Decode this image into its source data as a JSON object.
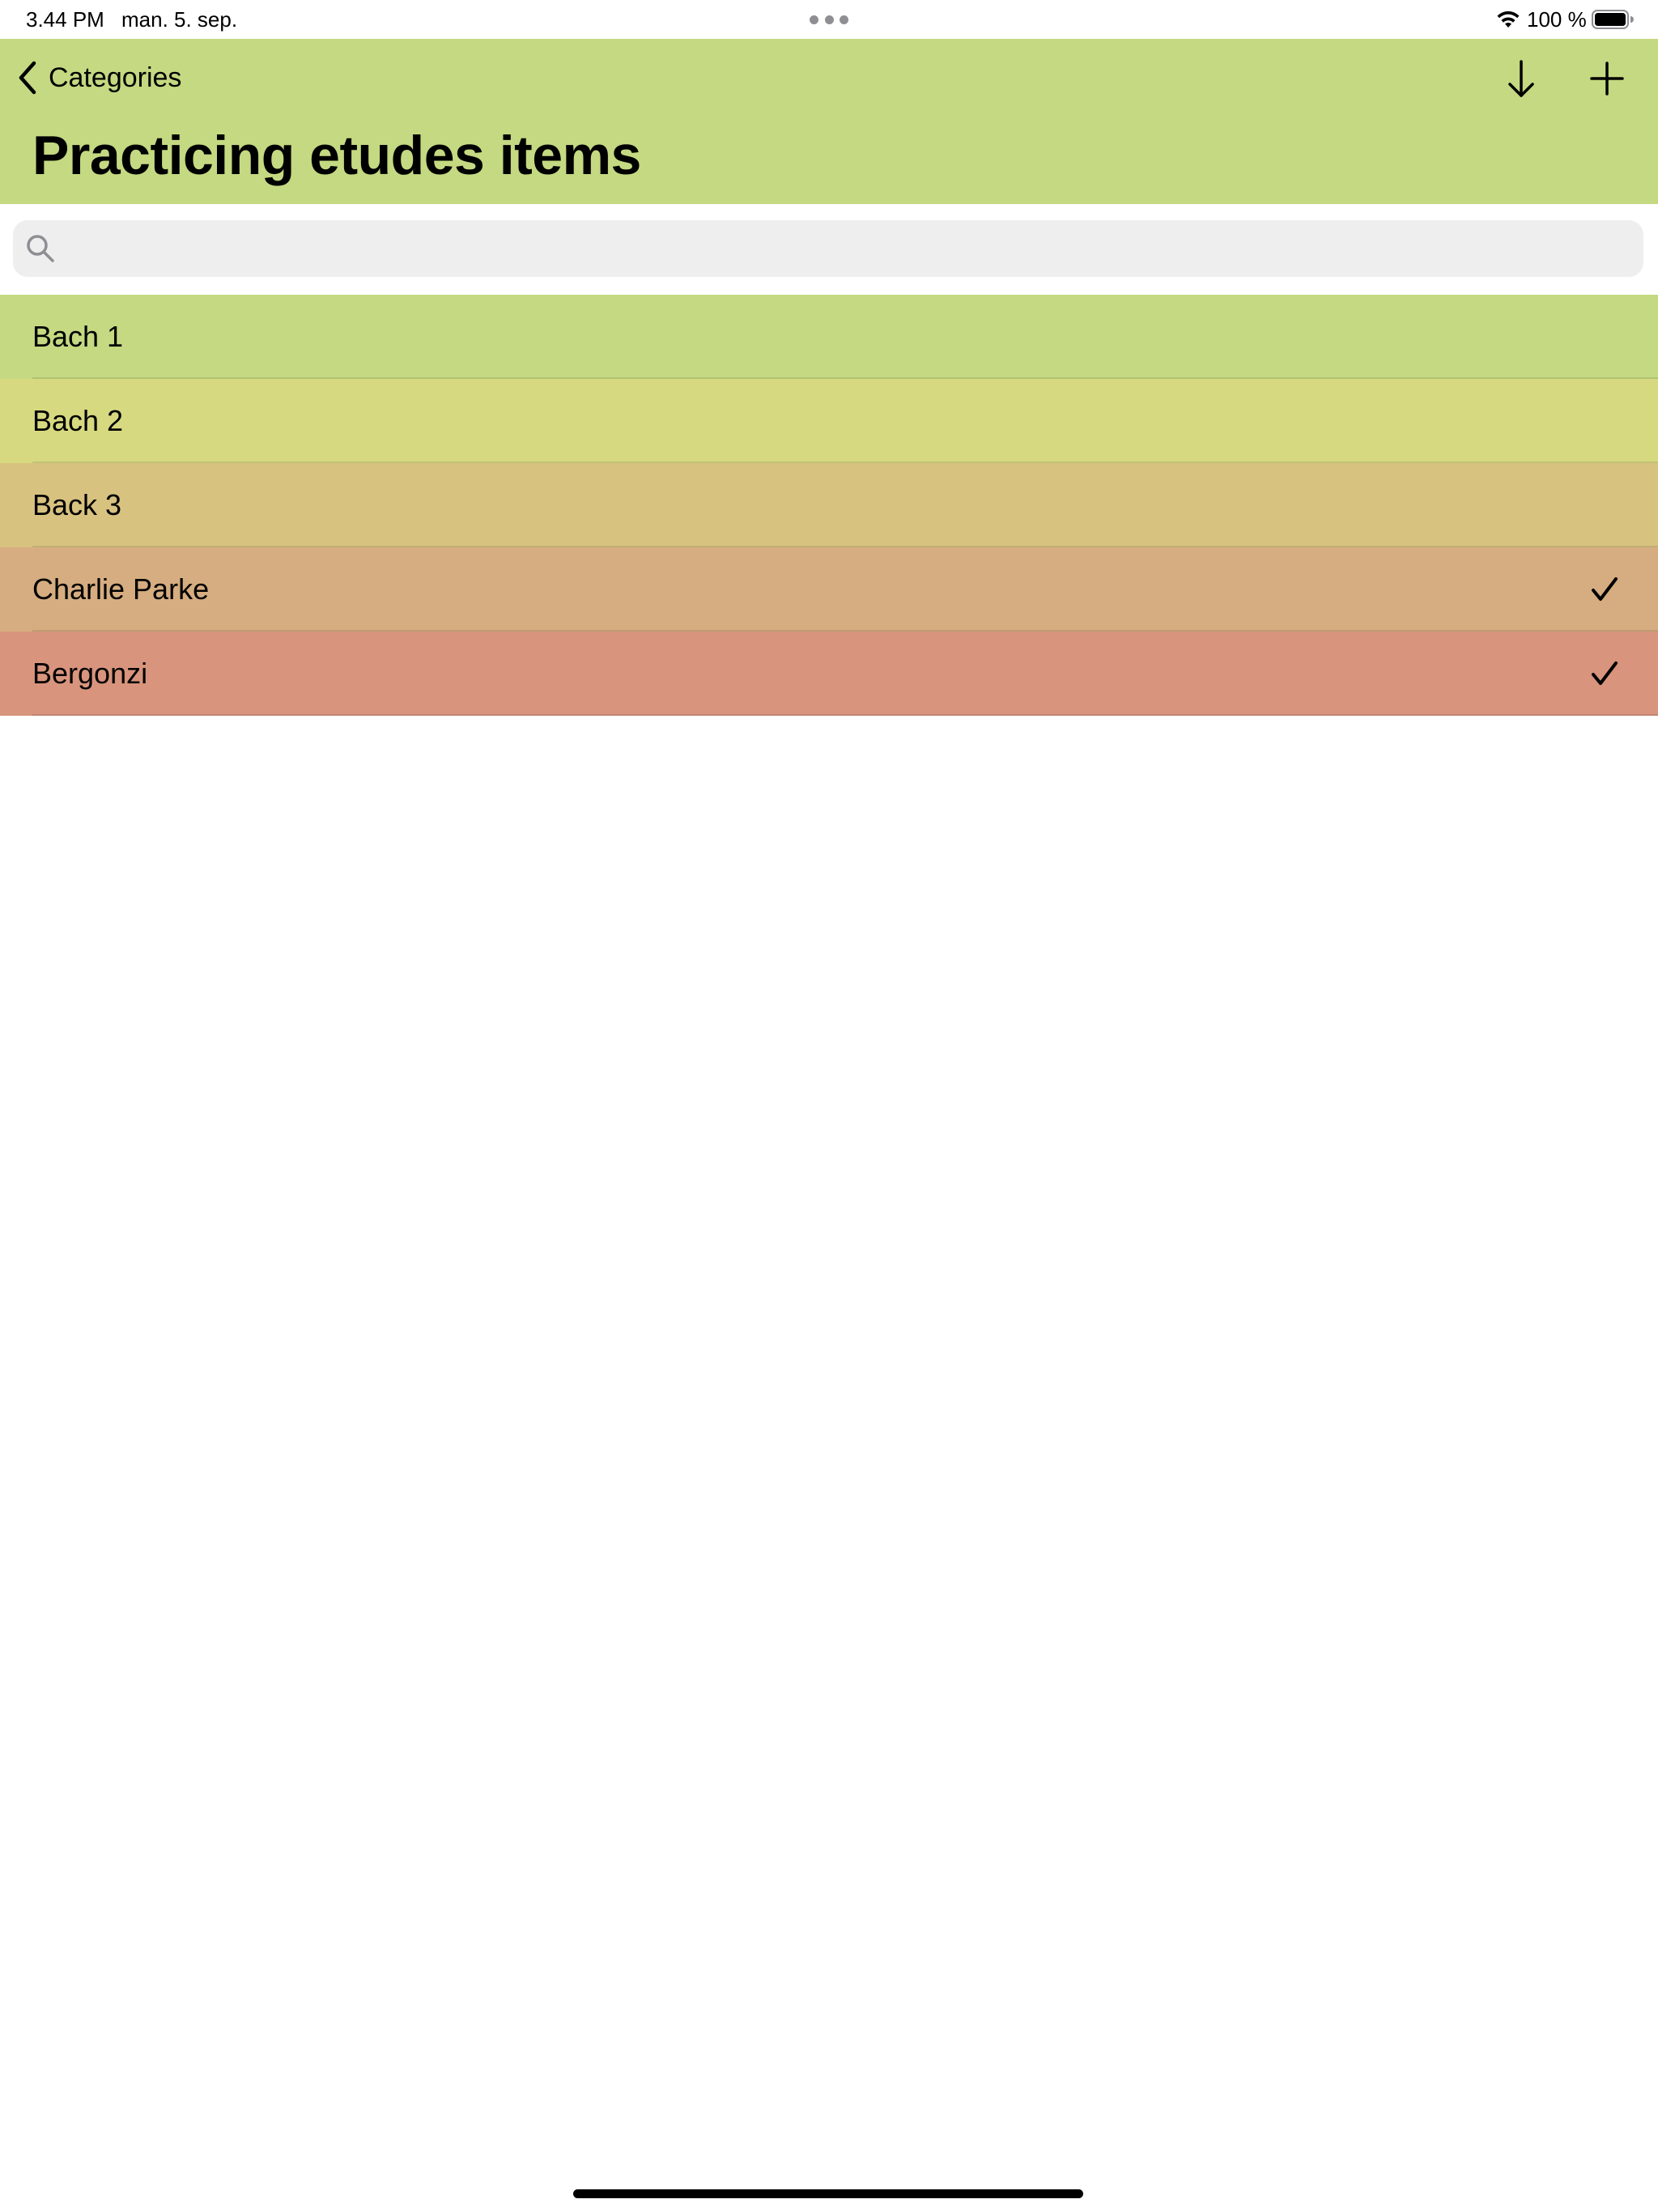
{
  "status_bar": {
    "time": "3.44 PM",
    "date": "man. 5. sep.",
    "battery": "100 %"
  },
  "nav": {
    "back_label": "Categories",
    "title": "Practicing etudes items",
    "background": "#c4d981"
  },
  "search": {
    "placeholder": "",
    "value": ""
  },
  "items": [
    {
      "label": "Bach 1",
      "color": "#c4d981",
      "checked": false
    },
    {
      "label": "Bach 2",
      "color": "#d7d980",
      "checked": false
    },
    {
      "label": "Back 3",
      "color": "#d8c280",
      "checked": false
    },
    {
      "label": "Charlie Parke",
      "color": "#d6ad80",
      "checked": true
    },
    {
      "label": "Bergonzi",
      "color": "#d8947c",
      "checked": true
    }
  ],
  "icons": {
    "back": "chevron-left-icon",
    "sort": "arrow-down-icon",
    "add": "plus-icon",
    "search": "search-icon",
    "check": "checkmark-icon"
  }
}
